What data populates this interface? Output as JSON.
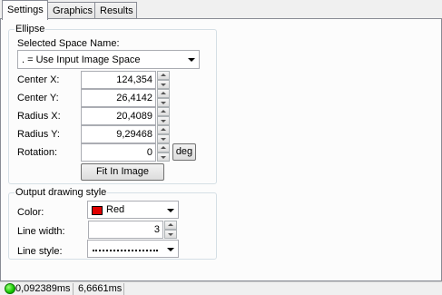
{
  "tabs": [
    {
      "label": "Settings",
      "active": true
    },
    {
      "label": "Graphics",
      "active": false
    },
    {
      "label": "Results",
      "active": false
    }
  ],
  "ellipse": {
    "title": "Ellipse",
    "space_label": "Selected Space Name:",
    "space_value": ". = Use Input Image Space",
    "fields": [
      {
        "label": "Center X:",
        "value": "124,354"
      },
      {
        "label": "Center Y:",
        "value": "26,4142"
      },
      {
        "label": "Radius X:",
        "value": "20,4089"
      },
      {
        "label": "Radius Y:",
        "value": "9,29468"
      },
      {
        "label": "Rotation:",
        "value": "0"
      }
    ],
    "deg_button": "deg",
    "fit_button": "Fit In Image"
  },
  "style": {
    "title": "Output drawing style",
    "color_label": "Color:",
    "color_value": "Red",
    "color_hex": "#e00000",
    "line_width_label": "Line width:",
    "line_width_value": "3",
    "line_style_label": "Line style:"
  },
  "status": {
    "indicator_color": "#14c800",
    "time1": "0,092389ms",
    "time2": "6,6661ms"
  }
}
